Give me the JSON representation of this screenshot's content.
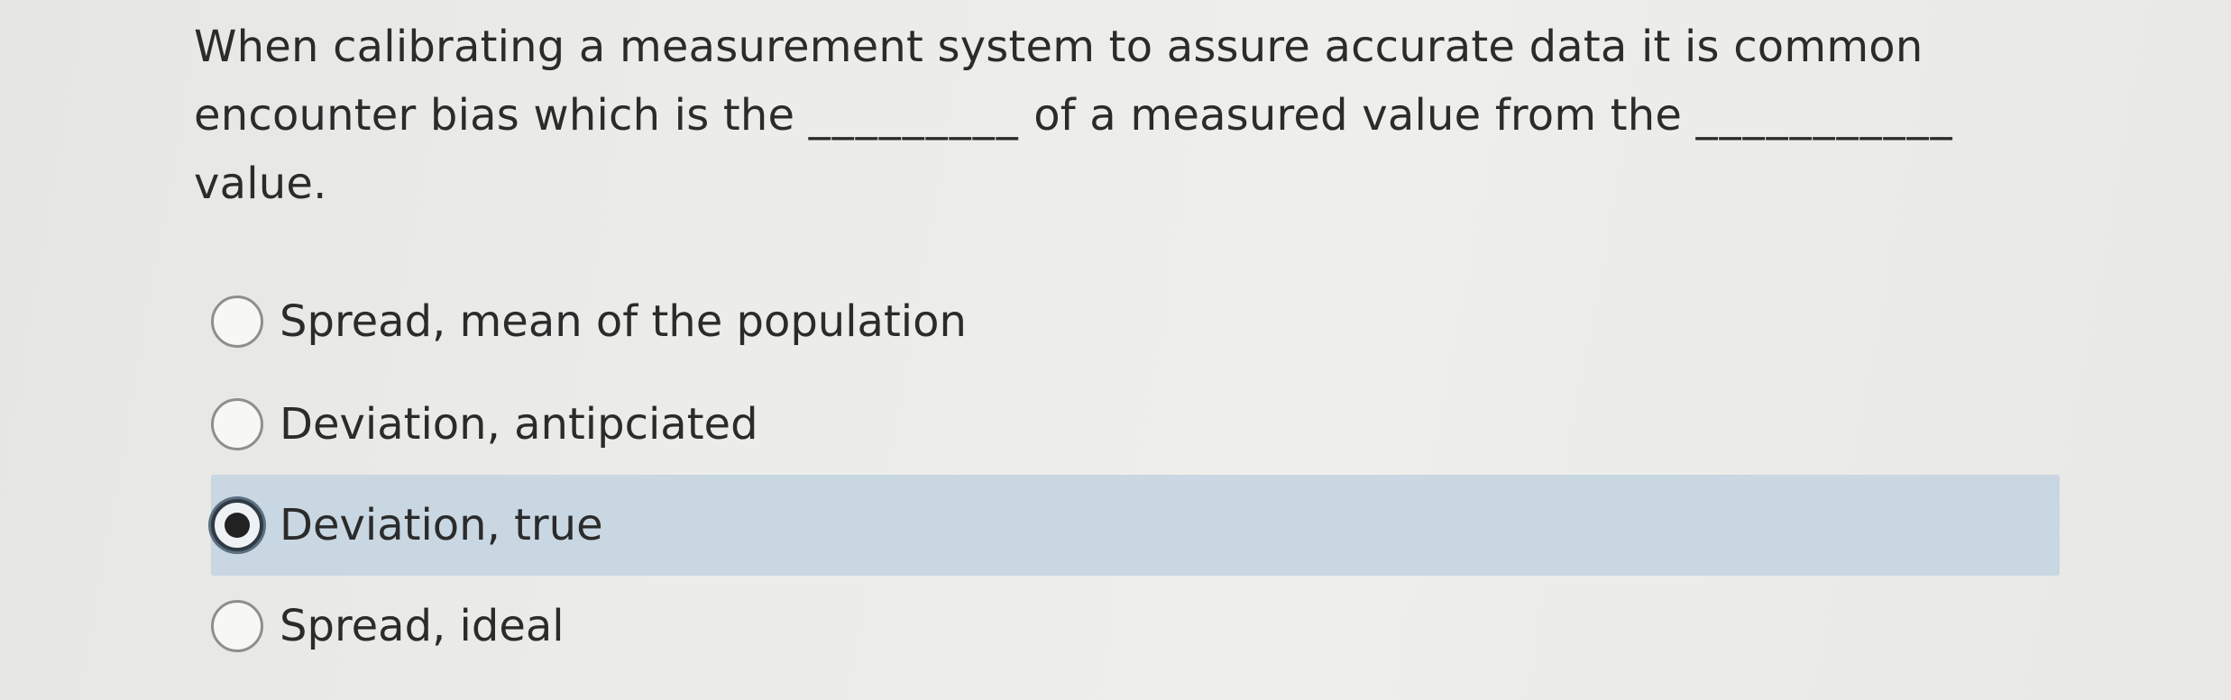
{
  "question": {
    "line1": "When calibrating a measurement system to assure accurate data it is common",
    "line2_part1": "encounter bias which is the",
    "blank1": "_________",
    "line2_part2": "of a measured value from the",
    "blank2": "___________",
    "line3": "value."
  },
  "options": [
    {
      "label": "Spread, mean of the population",
      "selected": false
    },
    {
      "label": "Deviation, antipciated",
      "selected": false
    },
    {
      "label": "Deviation, true",
      "selected": true
    },
    {
      "label": "Spread, ideal",
      "selected": false
    }
  ],
  "colors": {
    "selected_highlight": "#c9d7e2",
    "text": "#2b2b2b"
  }
}
